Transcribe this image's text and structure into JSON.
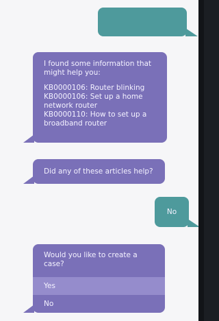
{
  "messages": {
    "user_1": "",
    "bot_info_intro": "I found some information that might help you:",
    "bot_info_articles": [
      "KB0000106: Router blinking",
      "KB0000106: Set up a home network router",
      "KB0000110: How to set up a broadband router"
    ],
    "bot_question": "Did any of these articles help?",
    "user_reply": "No",
    "bot_case_question": "Would you like to create a case?",
    "options": [
      "Yes",
      "No"
    ]
  },
  "colors": {
    "bot_bubble": "#7a70b8",
    "user_bubble": "#4e9a9c",
    "selected_option": "#958ccc",
    "background": "#f6f6f8"
  }
}
